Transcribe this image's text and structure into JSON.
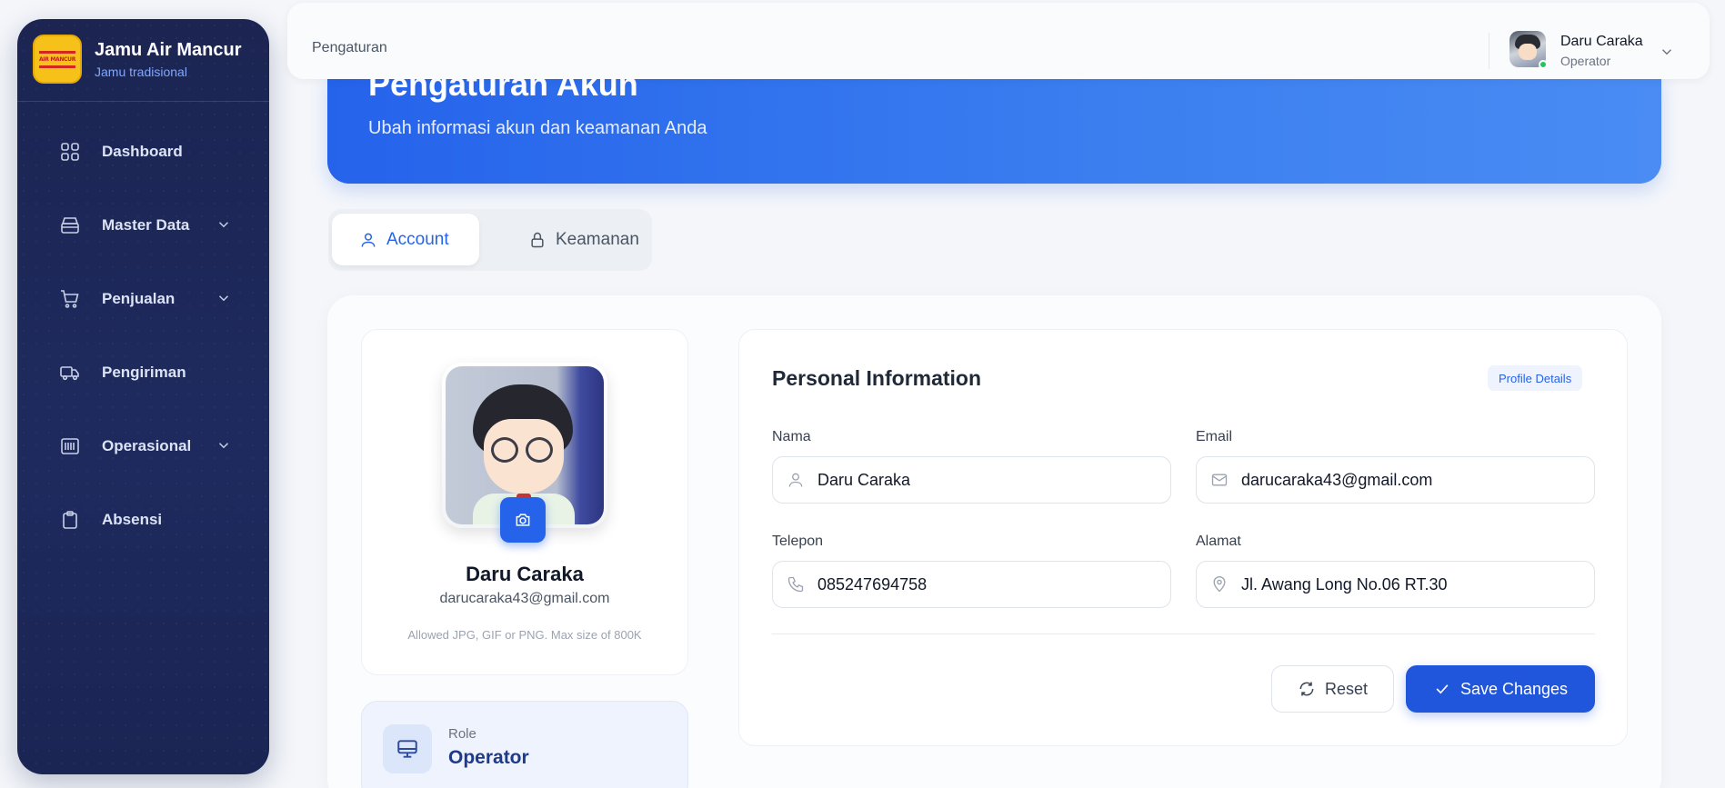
{
  "brand": {
    "title": "Jamu Air Mancur",
    "subtitle": "Jamu tradisional",
    "logo_text": "AIR MANCUR"
  },
  "sidebar": {
    "items": [
      {
        "label": "Dashboard",
        "icon": "grid-icon",
        "has_children": false
      },
      {
        "label": "Master Data",
        "icon": "box-icon",
        "has_children": true
      },
      {
        "label": "Penjualan",
        "icon": "cart-icon",
        "has_children": true
      },
      {
        "label": "Pengiriman",
        "icon": "truck-icon",
        "has_children": false
      },
      {
        "label": "Operasional",
        "icon": "barcode-icon",
        "has_children": true
      },
      {
        "label": "Absensi",
        "icon": "clipboard-icon",
        "has_children": false
      }
    ]
  },
  "header": {
    "breadcrumb": "Pengaturan",
    "user": {
      "name": "Daru Caraka",
      "role": "Operator",
      "status": "online"
    }
  },
  "banner": {
    "title": "Pengaturan Akun",
    "subtitle": "Ubah informasi akun dan keamanan Anda"
  },
  "tabs": [
    {
      "label": "Account",
      "active": true
    },
    {
      "label": "Keamanan",
      "active": false
    }
  ],
  "profile": {
    "name": "Daru Caraka",
    "email": "darucaraka43@gmail.com",
    "upload_hint": "Allowed JPG, GIF or PNG. Max size of 800K",
    "role_label": "Role",
    "role_value": "Operator"
  },
  "personal_info": {
    "title": "Personal Information",
    "badge": "Profile Details",
    "fields": {
      "nama": {
        "label": "Nama",
        "value": "Daru Caraka"
      },
      "email": {
        "label": "Email",
        "value": "darucaraka43@gmail.com"
      },
      "telepon": {
        "label": "Telepon",
        "value": "085247694758"
      },
      "alamat": {
        "label": "Alamat",
        "value": "Jl. Awang Long No.06 RT.30"
      }
    },
    "reset_label": "Reset",
    "save_label": "Save Changes"
  },
  "colors": {
    "primary": "#2563eb",
    "sidebar_bg": "#1e2a5e",
    "online": "#22c55e"
  }
}
